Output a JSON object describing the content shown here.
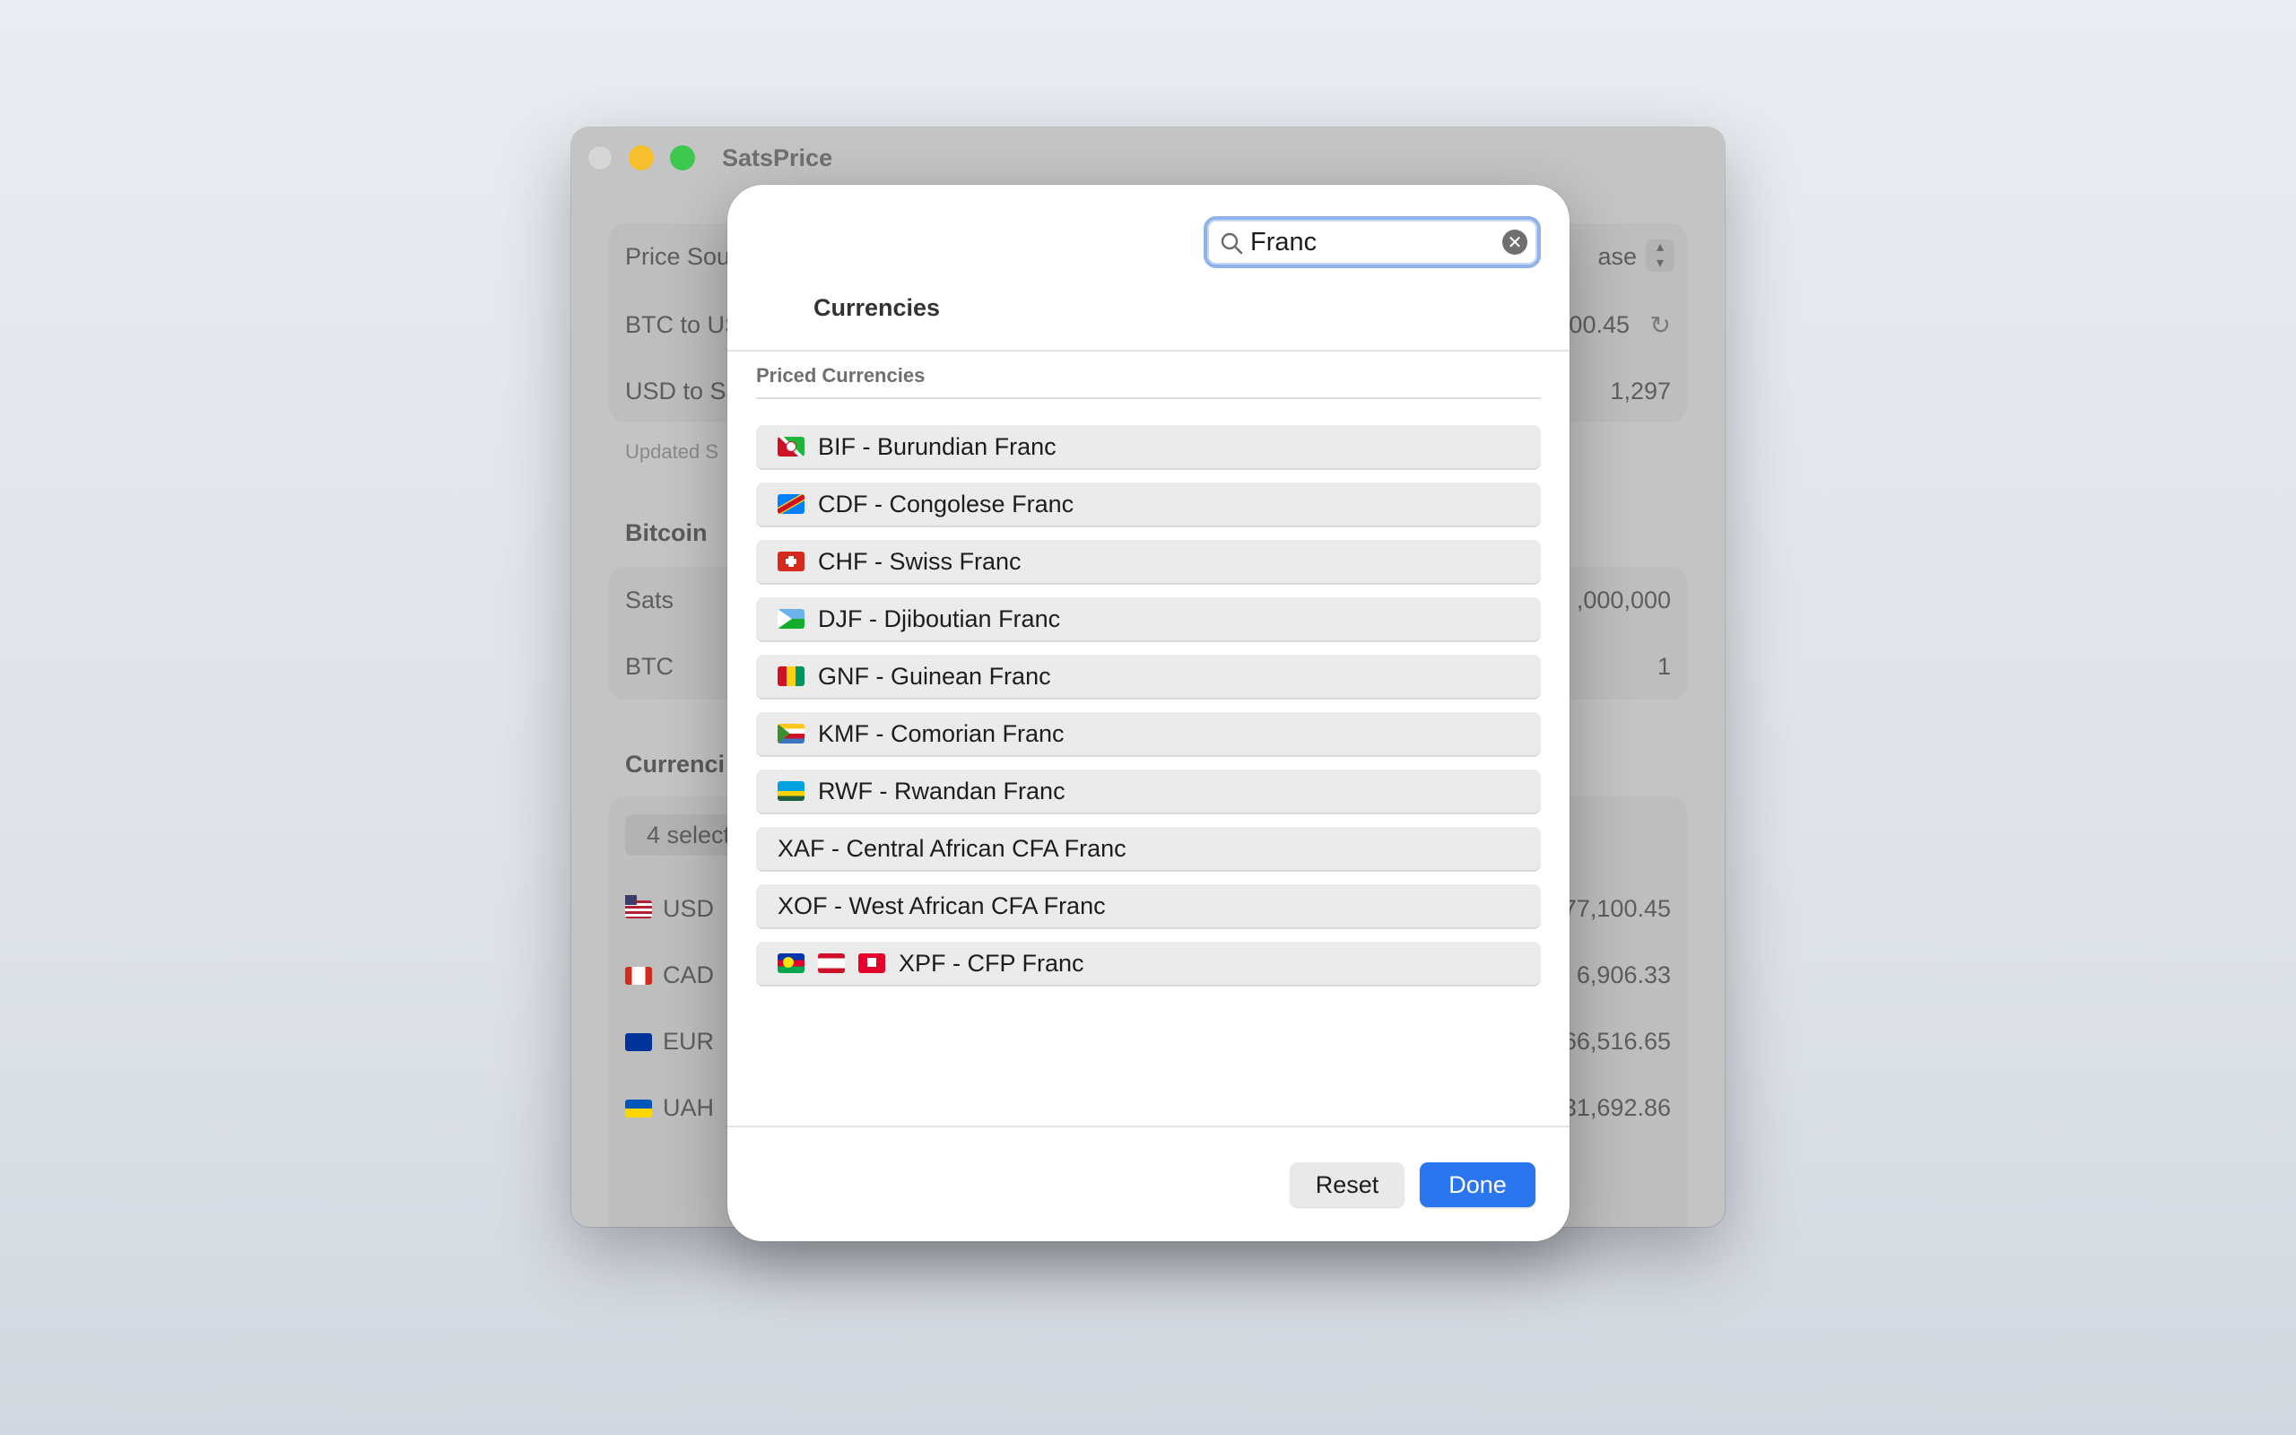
{
  "window": {
    "title": "SatsPrice",
    "price_source_label": "Price Sou",
    "price_source_value": "ase",
    "btc_to_usd_label": "BTC to US",
    "btc_to_usd_value": "00.45",
    "usd_to_sats_label": "USD to Sa",
    "usd_to_sats_value": "1,297",
    "updated_text": "Updated S",
    "bitcoin_section": "Bitcoin",
    "sats_label": "Sats",
    "sats_value": ",000,000",
    "btc_label": "BTC",
    "btc_value": "1",
    "currencies_section": "Currenci",
    "selected_button": "4 select",
    "rows": [
      {
        "code": "USD",
        "value": "77,100.45"
      },
      {
        "code": "CAD",
        "value": "6,906.33"
      },
      {
        "code": "EUR",
        "value": "66,516.65"
      },
      {
        "code": "UAH",
        "value": "31,692.86"
      }
    ]
  },
  "dialog": {
    "title": "Currencies",
    "search": {
      "value": "Franc",
      "placeholder": "Search"
    },
    "section_header": "Priced Currencies",
    "items": [
      {
        "label": "BIF - Burundian Franc"
      },
      {
        "label": "CDF - Congolese Franc"
      },
      {
        "label": "CHF - Swiss Franc"
      },
      {
        "label": "DJF - Djiboutian Franc"
      },
      {
        "label": "GNF - Guinean Franc"
      },
      {
        "label": "KMF - Comorian Franc"
      },
      {
        "label": "RWF - Rwandan Franc"
      },
      {
        "label": "XAF - Central African CFA Franc"
      },
      {
        "label": "XOF - West African CFA Franc"
      },
      {
        "label": "XPF - CFP Franc"
      }
    ],
    "reset_label": "Reset",
    "done_label": "Done"
  },
  "colors": {
    "accent": "#2b76ee",
    "search_focus_ring": "#8fb2ea",
    "row_background": "#ebebeb",
    "traffic_min": "#f5bf2d",
    "traffic_max": "#3fc84f"
  },
  "icons": [
    "search-icon",
    "clear-icon",
    "stepper-icon",
    "refresh-icon"
  ]
}
